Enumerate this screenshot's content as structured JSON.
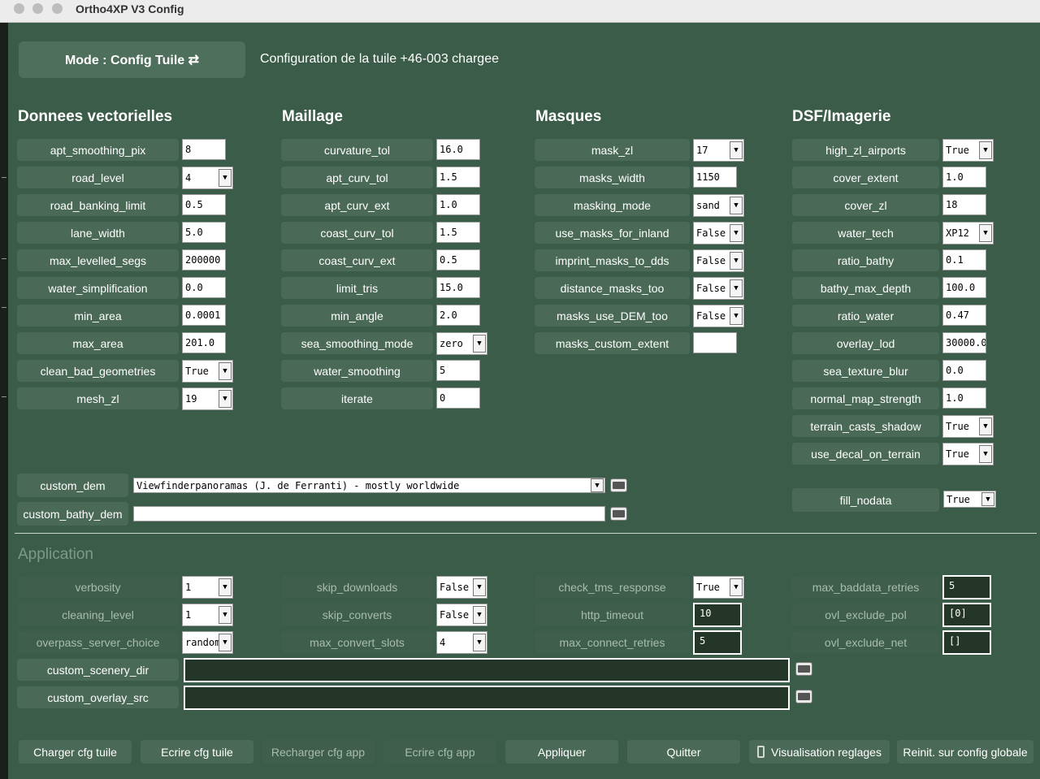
{
  "window": {
    "title": "Ortho4XP V3 Config"
  },
  "header": {
    "mode_label": "Mode : Config Tuile ⇄",
    "status": "Configuration de la tuile +46-003 chargee"
  },
  "sections": {
    "vector": "Donnees vectorielles",
    "mesh": "Maillage",
    "masks": "Masques",
    "dsf": "DSF/Imagerie",
    "application": "Application"
  },
  "vector": [
    {
      "label": "apt_smoothing_pix",
      "value": "8"
    },
    {
      "label": "road_level",
      "value": "4"
    },
    {
      "label": "road_banking_limit",
      "value": "0.5"
    },
    {
      "label": "lane_width",
      "value": "5.0"
    },
    {
      "label": "max_levelled_segs",
      "value": "200000"
    },
    {
      "label": "water_simplification",
      "value": "0.0"
    },
    {
      "label": "min_area",
      "value": "0.0001"
    },
    {
      "label": "max_area",
      "value": "201.0"
    },
    {
      "label": "clean_bad_geometries",
      "value": "True"
    },
    {
      "label": "mesh_zl",
      "value": "19"
    }
  ],
  "mesh": [
    {
      "label": "curvature_tol",
      "value": "16.0"
    },
    {
      "label": "apt_curv_tol",
      "value": "1.5"
    },
    {
      "label": "apt_curv_ext",
      "value": "1.0"
    },
    {
      "label": "coast_curv_tol",
      "value": "1.5"
    },
    {
      "label": "coast_curv_ext",
      "value": "0.5"
    },
    {
      "label": "limit_tris",
      "value": "15.0"
    },
    {
      "label": "min_angle",
      "value": "2.0"
    },
    {
      "label": "sea_smoothing_mode",
      "value": "zero"
    },
    {
      "label": "water_smoothing",
      "value": "5"
    },
    {
      "label": "iterate",
      "value": "0"
    }
  ],
  "masks": [
    {
      "label": "mask_zl",
      "value": "17"
    },
    {
      "label": "masks_width",
      "value": "1150"
    },
    {
      "label": "masking_mode",
      "value": "sand"
    },
    {
      "label": "use_masks_for_inland",
      "value": "False"
    },
    {
      "label": "imprint_masks_to_dds",
      "value": "False"
    },
    {
      "label": "distance_masks_too",
      "value": "False"
    },
    {
      "label": "masks_use_DEM_too",
      "value": "False"
    },
    {
      "label": "masks_custom_extent",
      "value": ""
    }
  ],
  "dsf": [
    {
      "label": "high_zl_airports",
      "value": "True"
    },
    {
      "label": "cover_extent",
      "value": "1.0"
    },
    {
      "label": "cover_zl",
      "value": "18"
    },
    {
      "label": "water_tech",
      "value": "XP12"
    },
    {
      "label": "ratio_bathy",
      "value": "0.1"
    },
    {
      "label": "bathy_max_depth",
      "value": "100.0"
    },
    {
      "label": "ratio_water",
      "value": "0.47"
    },
    {
      "label": "overlay_lod",
      "value": "30000.0"
    },
    {
      "label": "sea_texture_blur",
      "value": "0.0"
    },
    {
      "label": "normal_map_strength",
      "value": "1.0"
    },
    {
      "label": "terrain_casts_shadow",
      "value": "True"
    },
    {
      "label": "use_decal_on_terrain",
      "value": "True"
    },
    {
      "label": "fill_nodata",
      "value": "True"
    }
  ],
  "dem": {
    "custom_dem_label": "custom_dem",
    "custom_dem_value": "Viewfinderpanoramas (J. de Ferranti) - mostly worldwide",
    "custom_bathy_label": "custom_bathy_dem",
    "custom_bathy_value": ""
  },
  "app": {
    "verbosity": {
      "label": "verbosity",
      "value": "1"
    },
    "cleaning_level": {
      "label": "cleaning_level",
      "value": "1"
    },
    "overpass": {
      "label": "overpass_server_choice",
      "value": "random"
    },
    "skip_downloads": {
      "label": "skip_downloads",
      "value": "False"
    },
    "skip_converts": {
      "label": "skip_converts",
      "value": "False"
    },
    "max_convert_slots": {
      "label": "max_convert_slots",
      "value": "4"
    },
    "check_tms": {
      "label": "check_tms_response",
      "value": "True"
    },
    "http_timeout": {
      "label": "http_timeout",
      "value": "10"
    },
    "max_connect": {
      "label": "max_connect_retries",
      "value": "5"
    },
    "max_baddata": {
      "label": "max_baddata_retries",
      "value": "5"
    },
    "ovl_pol": {
      "label": "ovl_exclude_pol",
      "value": "[0]"
    },
    "ovl_net": {
      "label": "ovl_exclude_net",
      "value": "[]"
    },
    "scenery_dir": {
      "label": "custom_scenery_dir",
      "value": ""
    },
    "overlay_src": {
      "label": "custom_overlay_src",
      "value": ""
    }
  },
  "buttons": {
    "load_tile": "Charger cfg tuile",
    "write_tile": "Ecrire cfg tuile",
    "reload_app": "Recharger cfg app",
    "write_app": "Ecrire cfg app",
    "apply": "Appliquer",
    "quit": "Quitter",
    "visualize": "Visualisation reglages",
    "reset": "Reinit. sur config globale",
    "visualize_icon": "phone-icon"
  }
}
